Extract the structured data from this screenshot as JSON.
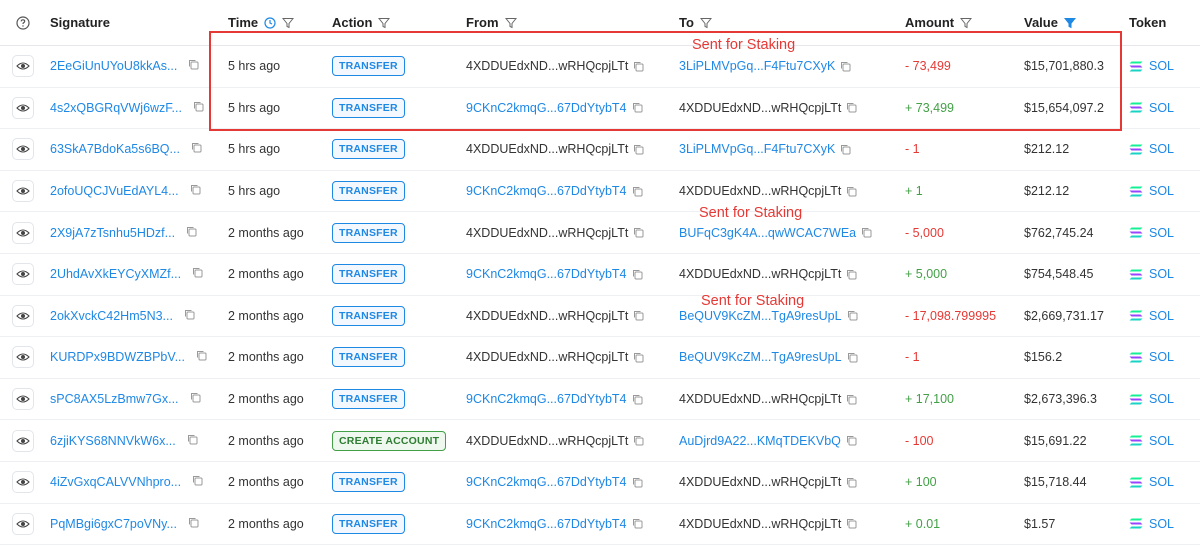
{
  "header": {
    "help_icon": "question-circle-icon",
    "signature": "Signature",
    "time": "Time",
    "action": "Action",
    "from": "From",
    "to": "To",
    "amount": "Amount",
    "value": "Value",
    "token": "Token"
  },
  "annotations": {
    "a1": "Sent for Staking",
    "a2": "Sent for Staking",
    "a3": "Sent for Staking"
  },
  "colors": {
    "link": "#1e88e5",
    "negative": "#e53935",
    "positive": "#43a047",
    "highlight": "#e53935",
    "active_filter": "#1e88e5"
  },
  "rows": [
    {
      "signature": "2EeGiUnUYoU8kkAs...",
      "time": "5 hrs ago",
      "action": "TRANSFER",
      "from": "4XDDUEdxND...wRHQcpjLTt",
      "to": "3LiPLMVpGq...F4Ftu7CXyK",
      "amount": "- 73,499",
      "value": "$15,701,880.3",
      "token": "SOL"
    },
    {
      "signature": "4s2xQBGRqVWj6wzF...",
      "time": "5 hrs ago",
      "action": "TRANSFER",
      "from": "9CKnC2kmqG...67DdYtybT4",
      "to": "4XDDUEdxND...wRHQcpjLTt",
      "amount": "+ 73,499",
      "value": "$15,654,097.2",
      "token": "SOL"
    },
    {
      "signature": "63SkA7BdoKa5s6BQ...",
      "time": "5 hrs ago",
      "action": "TRANSFER",
      "from": "4XDDUEdxND...wRHQcpjLTt",
      "to": "3LiPLMVpGq...F4Ftu7CXyK",
      "amount": "- 1",
      "value": "$212.12",
      "token": "SOL"
    },
    {
      "signature": "2ofoUQCJVuEdAYL4...",
      "time": "5 hrs ago",
      "action": "TRANSFER",
      "from": "9CKnC2kmqG...67DdYtybT4",
      "to": "4XDDUEdxND...wRHQcpjLTt",
      "amount": "+ 1",
      "value": "$212.12",
      "token": "SOL"
    },
    {
      "signature": "2X9jA7zTsnhu5HDzf...",
      "time": "2 months ago",
      "action": "TRANSFER",
      "from": "4XDDUEdxND...wRHQcpjLTt",
      "to": "BUFqC3gK4A...qwWCAC7WEa",
      "amount": "- 5,000",
      "value": "$762,745.24",
      "token": "SOL"
    },
    {
      "signature": "2UhdAvXkEYCyXMZf...",
      "time": "2 months ago",
      "action": "TRANSFER",
      "from": "9CKnC2kmqG...67DdYtybT4",
      "to": "4XDDUEdxND...wRHQcpjLTt",
      "amount": "+ 5,000",
      "value": "$754,548.45",
      "token": "SOL"
    },
    {
      "signature": "2okXvckC42Hm5N3...",
      "time": "2 months ago",
      "action": "TRANSFER",
      "from": "4XDDUEdxND...wRHQcpjLTt",
      "to": "BeQUV9KcZM...TgA9resUpL",
      "amount": "- 17,098.799995",
      "value": "$2,669,731.17",
      "token": "SOL"
    },
    {
      "signature": "KURDPx9BDWZBPbV...",
      "time": "2 months ago",
      "action": "TRANSFER",
      "from": "4XDDUEdxND...wRHQcpjLTt",
      "to": "BeQUV9KcZM...TgA9resUpL",
      "amount": "- 1",
      "value": "$156.2",
      "token": "SOL"
    },
    {
      "signature": "sPC8AX5LzBmw7Gx...",
      "time": "2 months ago",
      "action": "TRANSFER",
      "from": "9CKnC2kmqG...67DdYtybT4",
      "to": "4XDDUEdxND...wRHQcpjLTt",
      "amount": "+ 17,100",
      "value": "$2,673,396.3",
      "token": "SOL"
    },
    {
      "signature": "6zjiKYS68NNVkW6x...",
      "time": "2 months ago",
      "action": "CREATE ACCOUNT",
      "from": "4XDDUEdxND...wRHQcpjLTt",
      "to": "AuDjrd9A22...KMqTDEKVbQ",
      "amount": "- 100",
      "value": "$15,691.22",
      "token": "SOL"
    },
    {
      "signature": "4iZvGxqCALVVNhpro...",
      "time": "2 months ago",
      "action": "TRANSFER",
      "from": "9CKnC2kmqG...67DdYtybT4",
      "to": "4XDDUEdxND...wRHQcpjLTt",
      "amount": "+ 100",
      "value": "$15,718.44",
      "token": "SOL"
    },
    {
      "signature": "PqMBgi6gxC7poVNy...",
      "time": "2 months ago",
      "action": "TRANSFER",
      "from": "9CKnC2kmqG...67DdYtybT4",
      "to": "4XDDUEdxND...wRHQcpjLTt",
      "amount": "+ 0.01",
      "value": "$1.57",
      "token": "SOL"
    }
  ]
}
